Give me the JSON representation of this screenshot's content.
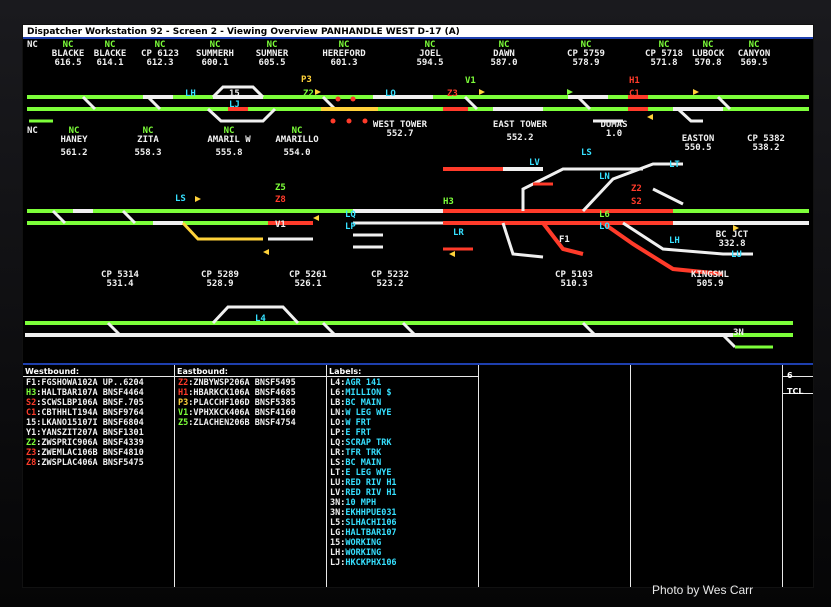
{
  "title": "Dispatcher Workstation 92 - Screen 2  -  Viewing Overview  PANHANDLE WEST    D-17  (A)",
  "photo_credit": "Photo by Wes Carr",
  "colors": {
    "green": "#7dff3a",
    "white": "#f0f0f0",
    "red": "#ff3b2a",
    "yellow": "#ffd23a",
    "cyan": "#36e0ff"
  },
  "row1": {
    "nc": "NC",
    "locations": [
      {
        "ind": "NC",
        "name": "BLACKE",
        "mp": "616.5"
      },
      {
        "ind": "NC",
        "name": "BLACKE",
        "mp": "614.1"
      },
      {
        "ind": "NC",
        "name": "CP 6123",
        "mp": "612.3"
      },
      {
        "ind": "NC",
        "name": "SUMMERH",
        "mp": "600.1"
      },
      {
        "ind": "NC",
        "name": "SUMNER",
        "mp": "605.5"
      },
      {
        "ind": "NC",
        "name": "HEREFORD",
        "mp": "601.3"
      },
      {
        "ind": "NC",
        "name": "JOEL",
        "mp": "594.5"
      },
      {
        "ind": "NC",
        "name": "DAWN",
        "mp": "587.0"
      },
      {
        "ind": "NC",
        "name": "CP 5759",
        "mp": "578.9"
      },
      {
        "ind": "NC",
        "name": "CP 5718",
        "mp": "571.8"
      },
      {
        "ind": "NC",
        "name": "LUBOCK",
        "mp": "570.8"
      },
      {
        "ind": "NC",
        "name": "CANYON",
        "mp": "569.5"
      }
    ],
    "tags": [
      {
        "t": "LH"
      },
      {
        "t": "15"
      },
      {
        "t": "LJ"
      },
      {
        "t": "P3"
      },
      {
        "t": "Z2"
      },
      {
        "t": "LO"
      },
      {
        "t": "Z3"
      },
      {
        "t": "V1"
      },
      {
        "t": "H1"
      },
      {
        "t": "C1"
      }
    ]
  },
  "row2": {
    "nc": "NC",
    "locations": [
      {
        "ind": "NC",
        "name": "HANEY",
        "mp": "561.2"
      },
      {
        "ind": "NC",
        "name": "ZITA",
        "mp": "558.3"
      },
      {
        "ind": "NC",
        "name": "AMARIL W",
        "mp": "555.8"
      },
      {
        "ind": "NC",
        "name": "AMARILLO",
        "mp": "554.0"
      },
      {
        "ind": "",
        "name": "WEST TOWER",
        "mp": "552.7"
      },
      {
        "ind": "",
        "name": "EAST TOWER",
        "mp": "552.2"
      },
      {
        "ind": "",
        "name": "DUMAS",
        "mp": "1.0"
      },
      {
        "ind": "",
        "name": "EASTON",
        "mp": "550.5"
      },
      {
        "ind": "",
        "name": "CP 5382",
        "mp": "538.2"
      },
      {
        "ind": "",
        "name": "BC JCT",
        "mp": "332.8"
      }
    ],
    "tags": [
      {
        "t": "LS"
      },
      {
        "t": "Z5"
      },
      {
        "t": "Z8"
      },
      {
        "t": "V1"
      },
      {
        "t": "LQ"
      },
      {
        "t": "LP"
      },
      {
        "t": "H3"
      },
      {
        "t": "LR"
      },
      {
        "t": "LV"
      },
      {
        "t": "LS"
      },
      {
        "t": "LN"
      },
      {
        "t": "LT"
      },
      {
        "t": "Z2"
      },
      {
        "t": "S2"
      },
      {
        "t": "L6"
      },
      {
        "t": "LO"
      },
      {
        "t": "F1"
      },
      {
        "t": "LH"
      },
      {
        "t": "LU"
      }
    ]
  },
  "row3": {
    "locations": [
      {
        "ind": "",
        "name": "CP 5314",
        "mp": "531.4"
      },
      {
        "ind": "",
        "name": "CP 5289",
        "mp": "528.9"
      },
      {
        "ind": "",
        "name": "CP 5261",
        "mp": "526.1"
      },
      {
        "ind": "",
        "name": "CP 5232",
        "mp": "523.2"
      },
      {
        "ind": "",
        "name": "CP 5103",
        "mp": "510.3"
      },
      {
        "ind": "",
        "name": "KINGSML",
        "mp": "505.9"
      }
    ],
    "tags": [
      {
        "t": "L4"
      },
      {
        "t": "3N"
      }
    ]
  },
  "panel": {
    "westbound": {
      "header": "Westbound:",
      "rows": [
        {
          "sym": "F1",
          "train": "FGSHOWA102A UP..6204",
          "color": "#f0f0f0"
        },
        {
          "sym": "H3",
          "train": "HALTBAR107A BNSF4464",
          "color": "#7dff3a"
        },
        {
          "sym": "S2",
          "train": "SCWSLBP106A BNSF.705",
          "color": "#ff3b2a"
        },
        {
          "sym": "C1",
          "train": "CBTHHLT194A BNSF9764",
          "color": "#ff3b2a"
        },
        {
          "sym": "15",
          "train": "LKANO15107I BNSF6804",
          "color": "#f0f0f0"
        },
        {
          "sym": "Y1",
          "train": "YANSZIT207A BNSF1301",
          "color": "#f0f0f0"
        },
        {
          "sym": "Z2",
          "train": "ZWSPRIC906A BNSF4339",
          "color": "#7dff3a"
        },
        {
          "sym": "Z3",
          "train": "ZWEMLAC106B BNSF4810",
          "color": "#ff3b2a"
        },
        {
          "sym": "Z8",
          "train": "ZWSPLAC406A BNSF5475",
          "color": "#ff3b2a"
        }
      ]
    },
    "eastbound": {
      "header": "Eastbound:",
      "rows": [
        {
          "sym": "Z2",
          "train": "ZNBYWSP206A BNSF5495",
          "color": "#ff3b2a"
        },
        {
          "sym": "H1",
          "train": "HBARKCK106A BNSF4685",
          "color": "#ff3b2a"
        },
        {
          "sym": "P3",
          "train": "PLACCHF106D BNSF5385",
          "color": "#ffd23a"
        },
        {
          "sym": "V1",
          "train": "VPHXKCK406A BNSF4160",
          "color": "#7dff3a"
        },
        {
          "sym": "Z5",
          "train": "ZLACHEN206B BNSF4754",
          "color": "#7dff3a"
        }
      ]
    },
    "labels": {
      "header": "Labels:",
      "rows": [
        {
          "sym": "L4",
          "text": "AGR 141"
        },
        {
          "sym": "L6",
          "text": "MILLION $"
        },
        {
          "sym": "LB",
          "text": "BC MAIN"
        },
        {
          "sym": "LN",
          "text": "W LEG WYE"
        },
        {
          "sym": "LO",
          "text": "W FRT"
        },
        {
          "sym": "LP",
          "text": "E FRT"
        },
        {
          "sym": "LQ",
          "text": "SCRAP TRK"
        },
        {
          "sym": "LR",
          "text": "TFR TRK"
        },
        {
          "sym": "LS",
          "text": "BC MAIN"
        },
        {
          "sym": "LT",
          "text": "E LEG WYE"
        },
        {
          "sym": "LU",
          "text": "RED RIV H1"
        },
        {
          "sym": "LV",
          "text": "RED RIV H1"
        },
        {
          "sym": "3N",
          "text": "10 MPH"
        },
        {
          "sym": "3N",
          "text": "EKHHPUE031"
        },
        {
          "sym": "L5",
          "text": "SLHACHI106"
        },
        {
          "sym": "LG",
          "text": "HALTBAR107"
        },
        {
          "sym": "15",
          "text": "WORKING"
        },
        {
          "sym": "LH",
          "text": "WORKING"
        },
        {
          "sym": "LJ",
          "text": "HKCKPHX106"
        }
      ]
    },
    "page": "6",
    "tcl": "TCL"
  }
}
